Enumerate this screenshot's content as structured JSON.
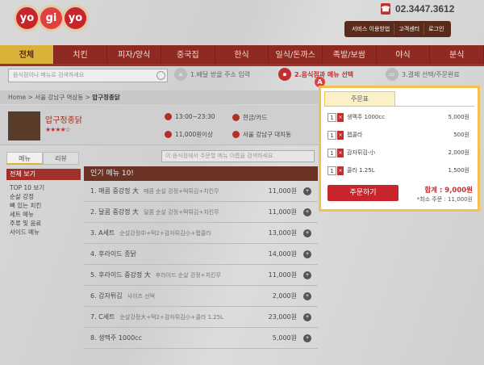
{
  "header": {
    "logo": [
      "yo",
      "gi",
      "yo"
    ],
    "phone": "02.3447.3612",
    "links": [
      "서비스 이용방법",
      "고객센터",
      "로그인"
    ]
  },
  "nav": {
    "items": [
      "전체",
      "치킨",
      "피자/양식",
      "중국집",
      "한식",
      "일식/돈까스",
      "족발/보쌈",
      "야식",
      "분식"
    ],
    "active_index": 0
  },
  "search": {
    "placeholder": "음식점이나 메뉴로 검색하세요"
  },
  "steps": [
    {
      "label": "1.배달 받을 주소 입력",
      "active": false
    },
    {
      "label": "2.음식점과 메뉴 선택",
      "active": true
    },
    {
      "label": "3.결제 선택/주문완료",
      "active": false
    }
  ],
  "badge": "A",
  "breadcrumb": {
    "home": "Home",
    "area": "서울 강남구 역삼동",
    "current": "압구정종닭"
  },
  "restaurant": {
    "name": "압구정종닭",
    "stars": "★★★★☆",
    "hours": "13:00~23:30",
    "payment": "현금/카드",
    "min_order": "11,000원이상",
    "location": "서울 강남구 대치동"
  },
  "tabs": [
    "메뉴",
    "리뷰"
  ],
  "menu_search": {
    "placeholder": "이 음식점에서 주문할 메뉴 이름을 검색하세요"
  },
  "sidebar": {
    "head": "전체 보기",
    "items": [
      "TOP 10 보기",
      "순살 강정",
      "뼈 있는 치킨",
      "세트 메뉴",
      "주류 및 음료",
      "사이드 메뉴"
    ]
  },
  "main": {
    "head": "인기 메뉴 10!",
    "rows": [
      {
        "name": "1. 매콤 중강정 大",
        "desc": "매콤 순살 강정+떡튀김+치킨무",
        "price": "11,000원"
      },
      {
        "name": "2. 달콤 중강정 大",
        "desc": "달콤 순살 강정+떡튀김+치킨무",
        "price": "11,000원"
      },
      {
        "name": "3. A세트",
        "desc": "순살강정中+떡2+감자튀김小+펩콜라",
        "price": "13,000원"
      },
      {
        "name": "4. 후라이드 종닭",
        "desc": "",
        "price": "14,000원"
      },
      {
        "name": "5. 후라이드 중강정 大",
        "desc": "후라이드 순살 강정+치킨무",
        "price": "11,000원"
      },
      {
        "name": "6. 감자튀김",
        "desc": "사이즈 선택",
        "price": "2,000원"
      },
      {
        "name": "7. C세트",
        "desc": "순살강정大+떡2+감자튀김小+콜라 1.25L",
        "price": "23,000원"
      },
      {
        "name": "8. 생맥주 1000cc",
        "desc": "",
        "price": "5,000원"
      }
    ]
  },
  "order": {
    "tab": "주문표",
    "items": [
      {
        "qty": "1",
        "name": "생맥주 1000cc",
        "price": "5,000원"
      },
      {
        "qty": "1",
        "name": "펩콜라",
        "price": "500원"
      },
      {
        "qty": "1",
        "name": "감자튀김-小",
        "price": "2,000원"
      },
      {
        "qty": "1",
        "name": "콜라 1.25L",
        "price": "1,500원"
      }
    ],
    "button": "주문하기",
    "total": "합계 : 9,000원",
    "min_order": "*최소 주문 : 11,000원"
  }
}
